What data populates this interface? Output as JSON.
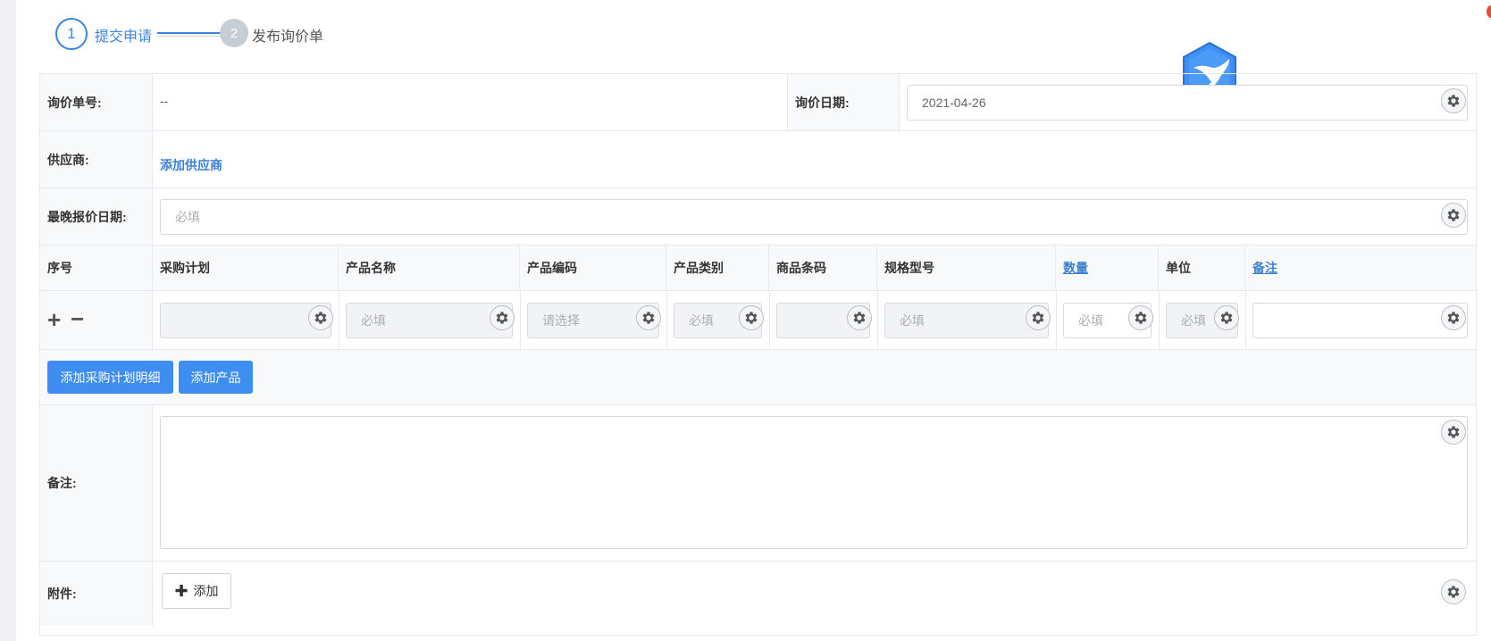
{
  "steps": [
    {
      "number": "1",
      "label": "提交申请"
    },
    {
      "number": "2",
      "label": "发布询价单"
    }
  ],
  "form": {
    "inquiry_no_label": "询价单号:",
    "inquiry_no_value": "--",
    "inquiry_date_label": "询价日期:",
    "inquiry_date_value": "2021-04-26",
    "supplier_label": "供应商:",
    "add_supplier_link": "添加供应商",
    "deadline_label": "最晚报价日期:",
    "deadline_placeholder": "必填",
    "remarks_label": "备注:",
    "attachment_label": "附件:",
    "attachment_add_button": "添加"
  },
  "table": {
    "columns": [
      "序号",
      "采购计划",
      "产品名称",
      "产品编码",
      "产品类别",
      "商品条码",
      "规格型号",
      "数量",
      "单位",
      "备注"
    ],
    "row": {
      "plus": "+",
      "minus": "−",
      "purchase_plan": "",
      "product_name_placeholder": "必填",
      "product_code_placeholder": "请选择",
      "product_category_placeholder": "必填",
      "barcode": "",
      "spec_placeholder": "必填",
      "quantity_placeholder": "必填",
      "unit_placeholder": "必填",
      "remark": ""
    },
    "buttons": {
      "add_plan_detail": "添加采购计划明细",
      "add_product": "添加产品"
    }
  },
  "colors": {
    "accent": "#3b84e0",
    "button_blue": "#3d8ef0",
    "border": "#e6e9ee",
    "label_bg": "#f8f9fa"
  },
  "icons": [
    "gear-icon",
    "bird-logo-icon",
    "plus-icon",
    "minus-icon"
  ]
}
